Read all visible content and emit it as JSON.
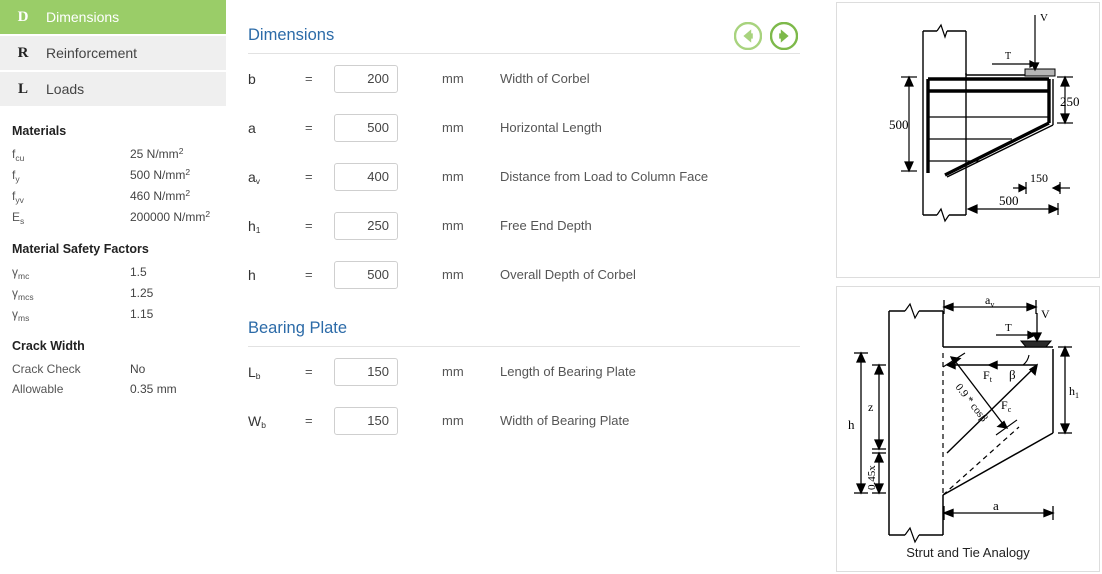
{
  "sidebar": {
    "nav": [
      {
        "key": "D",
        "label": "Dimensions",
        "active": true
      },
      {
        "key": "R",
        "label": "Reinforcement",
        "active": false
      },
      {
        "key": "L",
        "label": "Loads",
        "active": false
      }
    ],
    "materials": {
      "heading": "Materials",
      "rows": [
        {
          "sym": "f",
          "sub": "cu",
          "value": "25 N/mm",
          "sup": "2"
        },
        {
          "sym": "f",
          "sub": "y",
          "value": "500 N/mm",
          "sup": "2"
        },
        {
          "sym": "f",
          "sub": "yv",
          "value": "460 N/mm",
          "sup": "2"
        },
        {
          "sym": "E",
          "sub": "s",
          "value": "200000 N/mm",
          "sup": "2"
        }
      ]
    },
    "safety_factors": {
      "heading": "Material Safety Factors",
      "rows": [
        {
          "sym": "γ",
          "sub": "mc",
          "value": "1.5"
        },
        {
          "sym": "γ",
          "sub": "mcs",
          "value": "1.25"
        },
        {
          "sym": "γ",
          "sub": "ms",
          "value": "1.15"
        }
      ]
    },
    "crack_width": {
      "heading": "Crack Width",
      "rows": [
        {
          "label": "Crack Check",
          "value": "No"
        },
        {
          "label": "Allowable",
          "value": "0.35 mm"
        }
      ]
    }
  },
  "main": {
    "sections": [
      {
        "title": "Dimensions",
        "fields": [
          {
            "sym": "b",
            "sub": "",
            "eq": "=",
            "value": "200",
            "unit": "mm",
            "desc": "Width of Corbel"
          },
          {
            "sym": "a",
            "sub": "",
            "eq": "=",
            "value": "500",
            "unit": "mm",
            "desc": "Horizontal Length"
          },
          {
            "sym": "a",
            "sub": "v",
            "eq": "=",
            "value": "400",
            "unit": "mm",
            "desc": "Distance from Load to Column Face"
          },
          {
            "sym": "h",
            "sub": "1",
            "eq": "=",
            "value": "250",
            "unit": "mm",
            "desc": "Free End Depth"
          },
          {
            "sym": "h",
            "sub": "",
            "eq": "=",
            "value": "500",
            "unit": "mm",
            "desc": "Overall Depth of Corbel"
          }
        ]
      },
      {
        "title": "Bearing Plate",
        "fields": [
          {
            "sym": "L",
            "sub": "b",
            "eq": "=",
            "value": "150",
            "unit": "mm",
            "desc": "Length of Bearing Plate"
          },
          {
            "sym": "W",
            "sub": "b",
            "eq": "=",
            "value": "150",
            "unit": "mm",
            "desc": "Width of Bearing Plate"
          }
        ]
      }
    ],
    "arrows": {
      "prev": "previous-page-arrow",
      "next": "next-page-arrow",
      "prev_color": "#a8d37e",
      "next_color": "#7db94a"
    }
  },
  "diagrams": {
    "detail": {
      "labels": {
        "load": "V",
        "tension": "T",
        "depth_overall": "500",
        "depth_free_end": "250",
        "bearing": "150",
        "length": "500"
      }
    },
    "strut_tie": {
      "caption": "Strut and Tie Analogy",
      "labels": {
        "av": "a",
        "av_sub": "v",
        "load": "V",
        "tie": "T",
        "h1": "h",
        "h1_sub": "1",
        "h": "h",
        "z": "z",
        "x": "0.45x",
        "a": "a",
        "ft": "F",
        "ft_sub": "t",
        "fc": "F",
        "fc_sub": "c",
        "beta": "β",
        "strut_expr": "0.9 * cosβ"
      }
    }
  },
  "colors": {
    "accent_green": "#9acd68",
    "section_blue": "#2c6ba8",
    "nav_bg": "#efefef"
  }
}
